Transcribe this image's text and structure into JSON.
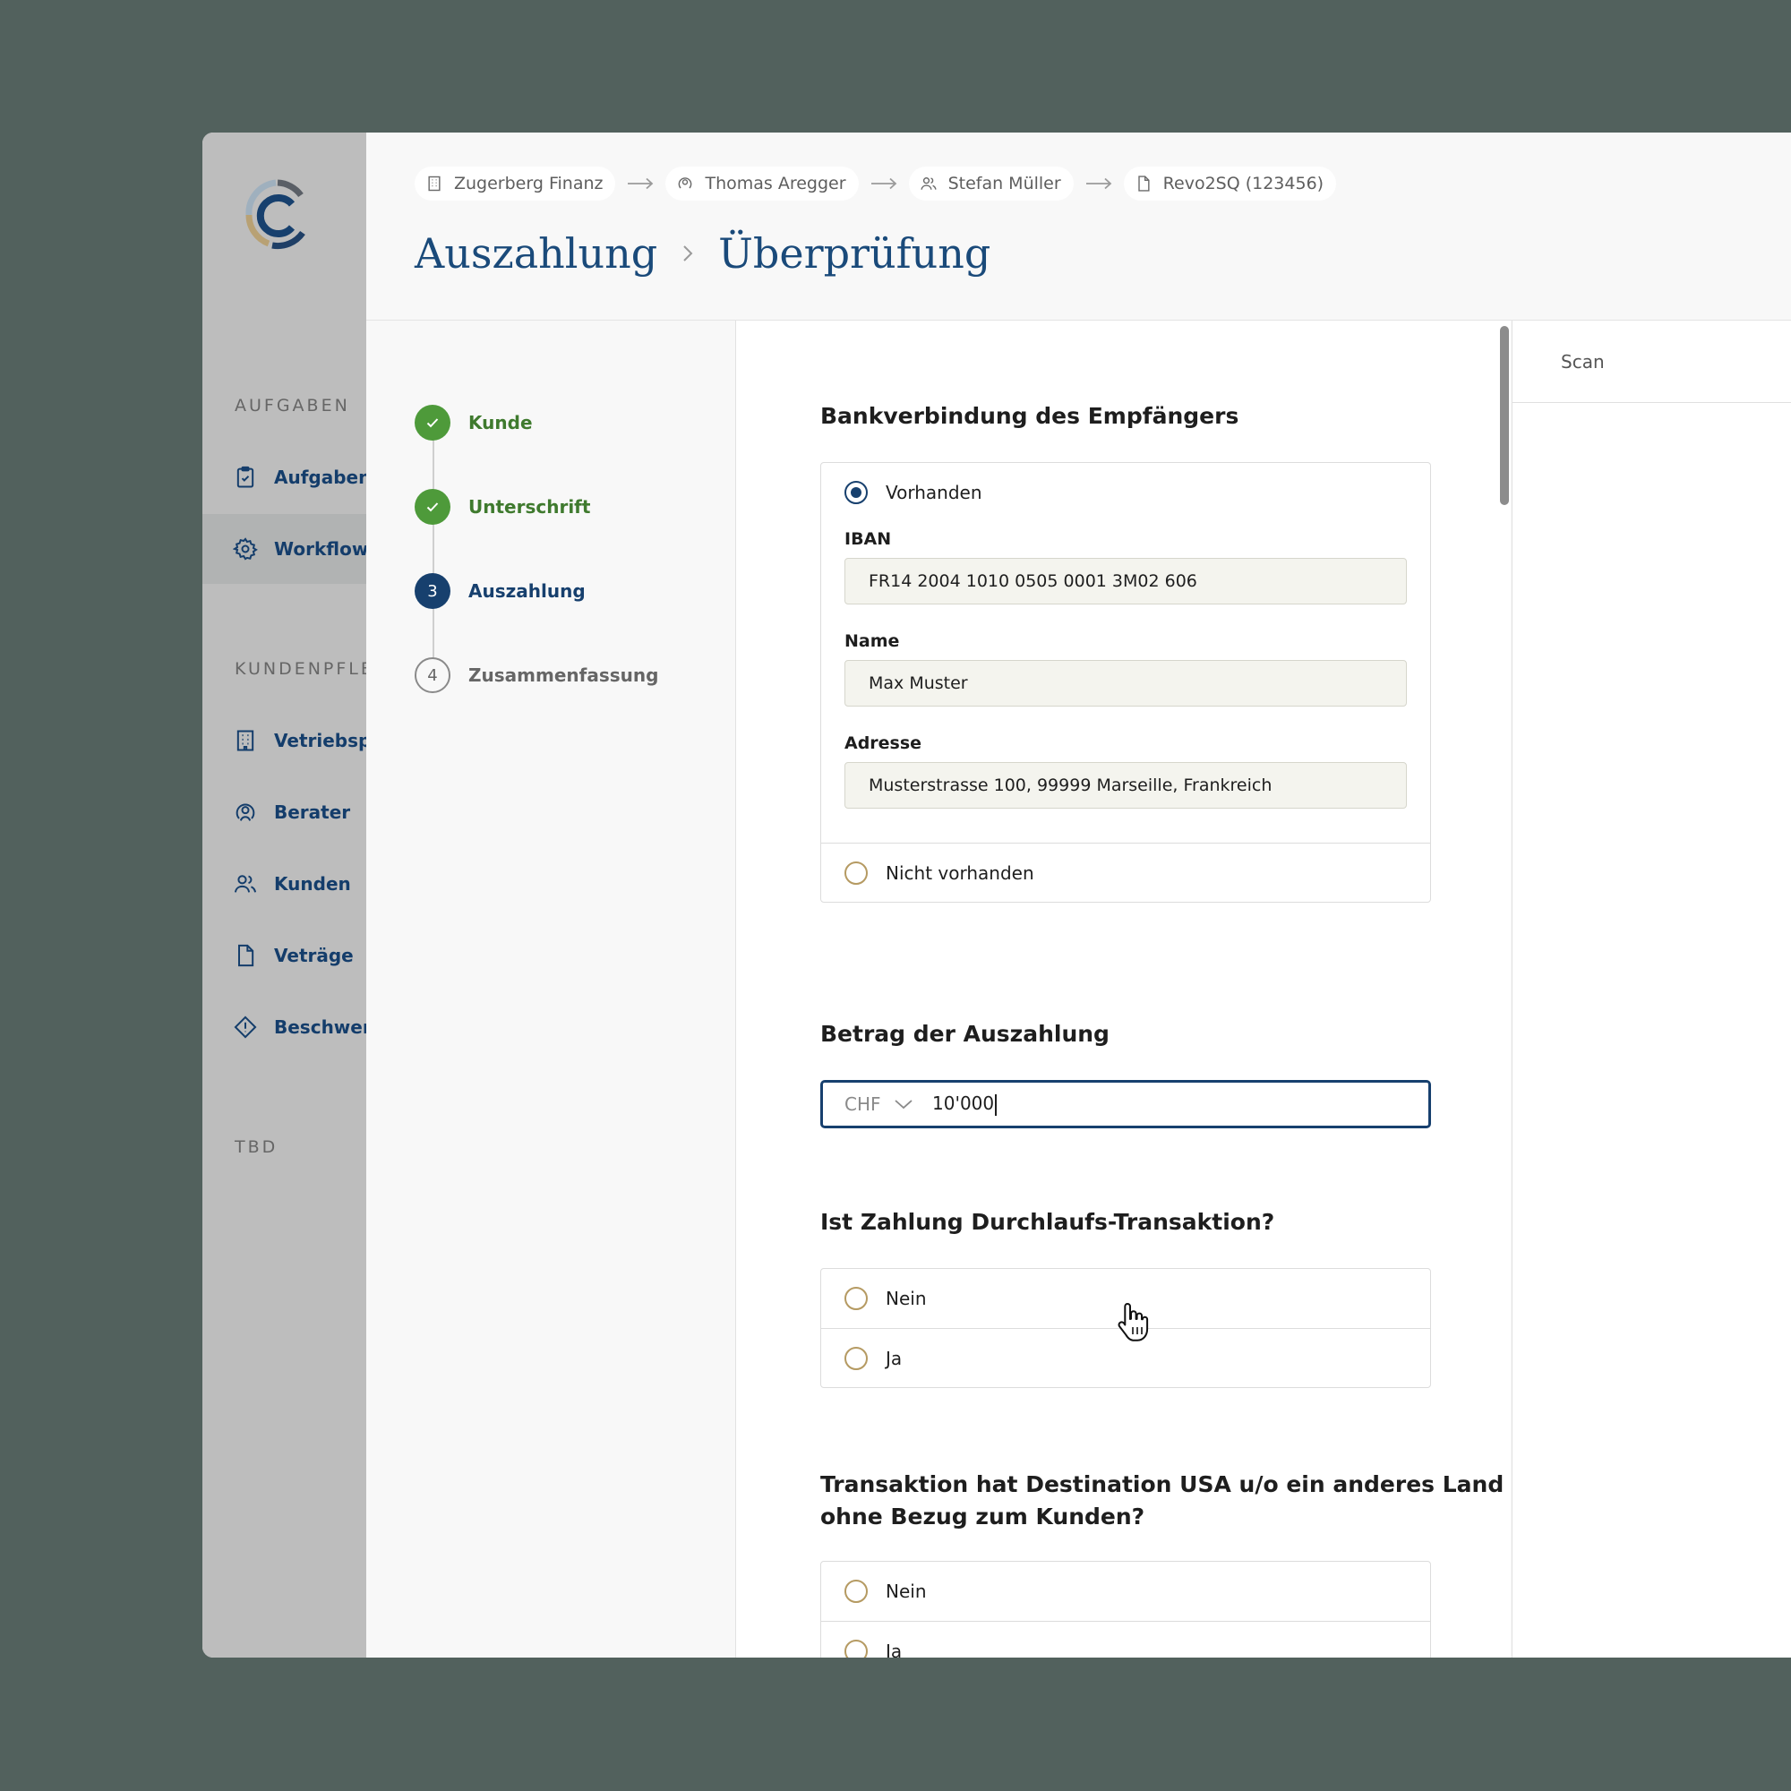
{
  "sidebar": {
    "sections": [
      "AUFGABEN",
      "KUNDENPFLEGE",
      "TBD"
    ],
    "items": [
      {
        "label": "Aufgaben",
        "icon": "clipboard-check-icon"
      },
      {
        "label": "Workflows",
        "icon": "gear-icon"
      },
      {
        "label": "Vetriebspartner",
        "icon": "building-icon"
      },
      {
        "label": "Berater",
        "icon": "advisor-icon"
      },
      {
        "label": "Kunden",
        "icon": "users-icon"
      },
      {
        "label": "Veträge",
        "icon": "document-icon"
      },
      {
        "label": "Beschwerden",
        "icon": "warning-diamond-icon"
      }
    ]
  },
  "breadcrumbs": [
    {
      "label": "Zugerberg Finanz",
      "icon": "building-icon"
    },
    {
      "label": "Thomas Aregger",
      "icon": "advisor-icon"
    },
    {
      "label": "Stefan Müller",
      "icon": "users-icon"
    },
    {
      "label": "Revo2SQ (123456)",
      "icon": "document-icon"
    }
  ],
  "title": {
    "part1": "Auszahlung",
    "part2": "Überprüfung"
  },
  "steps": [
    {
      "number": "1",
      "label": "Kunde",
      "status": "done"
    },
    {
      "number": "2",
      "label": "Unterschrift",
      "status": "done"
    },
    {
      "number": "3",
      "label": "Auszahlung",
      "status": "current"
    },
    {
      "number": "4",
      "label": "Zusammenfassung",
      "status": "todo"
    }
  ],
  "form": {
    "bank": {
      "title": "Bankverbindung des Empfängers",
      "option_yes": "Vorhanden",
      "option_no": "Nicht vorhanden",
      "iban_label": "IBAN",
      "iban_value": "FR14 2004 1010 0505 0001 3M02 606",
      "name_label": "Name",
      "name_value": "Max Muster",
      "address_label": "Adresse",
      "address_value": "Musterstrasse 100, 99999 Marseille, Frankreich"
    },
    "amount": {
      "title": "Betrag der Auszahlung",
      "currency": "CHF",
      "value": "10'000"
    },
    "transit": {
      "title": "Ist Zahlung Durchlaufs-Transaktion?",
      "option_no": "Nein",
      "option_yes": "Ja"
    },
    "destination": {
      "title_line1": "Transaktion hat Destination USA u/o ein anderes Land",
      "title_line2": "ohne Bezug zum Kunden?",
      "option_no": "Nein",
      "option_yes": "Ja"
    }
  },
  "right_pane": {
    "tab": "Scan"
  },
  "colors": {
    "primary": "#17406e",
    "success": "#4e9a3a",
    "background": "#52615d",
    "radio_border": "#b59a62"
  }
}
